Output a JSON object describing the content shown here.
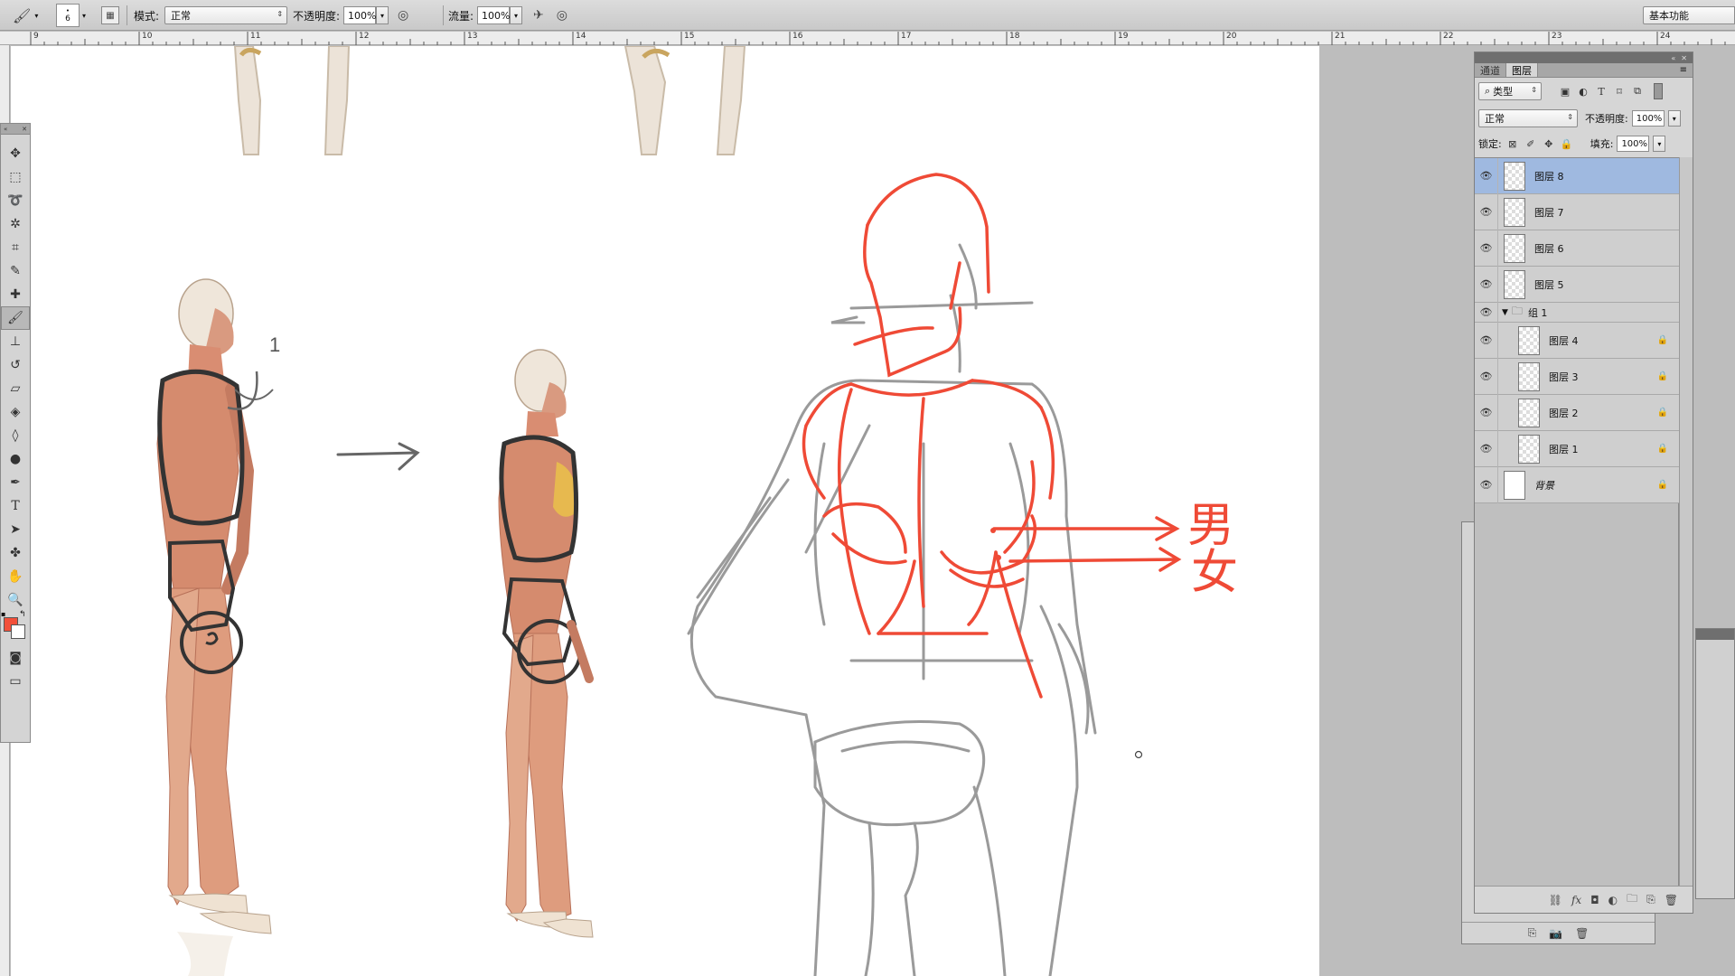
{
  "options_bar": {
    "brush_size": "6",
    "mode_label": "模式:",
    "mode_value": "正常",
    "opacity_label": "不透明度:",
    "opacity_value": "100%",
    "flow_label": "流量:",
    "flow_value": "100%",
    "workspace_value": "基本功能"
  },
  "ruler": {
    "ticks": [
      "9",
      "10",
      "11",
      "12",
      "13",
      "14",
      "15",
      "16",
      "17",
      "18",
      "19",
      "20",
      "21",
      "22",
      "23",
      "24"
    ]
  },
  "canvas": {
    "annotation_number": "1",
    "label_male": "男",
    "label_female": "女"
  },
  "colors": {
    "foreground": "#f2503a",
    "sketch_red": "#ef4a36",
    "sketch_gray": "#9a9a9a",
    "selection": "#9fb9e0"
  },
  "layers_panel": {
    "tabs": [
      "通道",
      "图层"
    ],
    "filter_value": "类型",
    "blend_mode": "正常",
    "opacity_label": "不透明度:",
    "opacity_value": "100%",
    "lock_label": "锁定:",
    "fill_label": "填充:",
    "fill_value": "100%",
    "group_name": "组 1",
    "layers": [
      {
        "name": "图层 8",
        "selected": true
      },
      {
        "name": "图层 7"
      },
      {
        "name": "图层 6"
      },
      {
        "name": "图层 5"
      },
      {
        "name": "图层 4",
        "locked": true
      },
      {
        "name": "图层 3",
        "locked": true
      },
      {
        "name": "图层 2",
        "locked": true
      },
      {
        "name": "图层 1",
        "locked": true
      },
      {
        "name": "背景",
        "locked": true,
        "italic": true
      }
    ]
  }
}
